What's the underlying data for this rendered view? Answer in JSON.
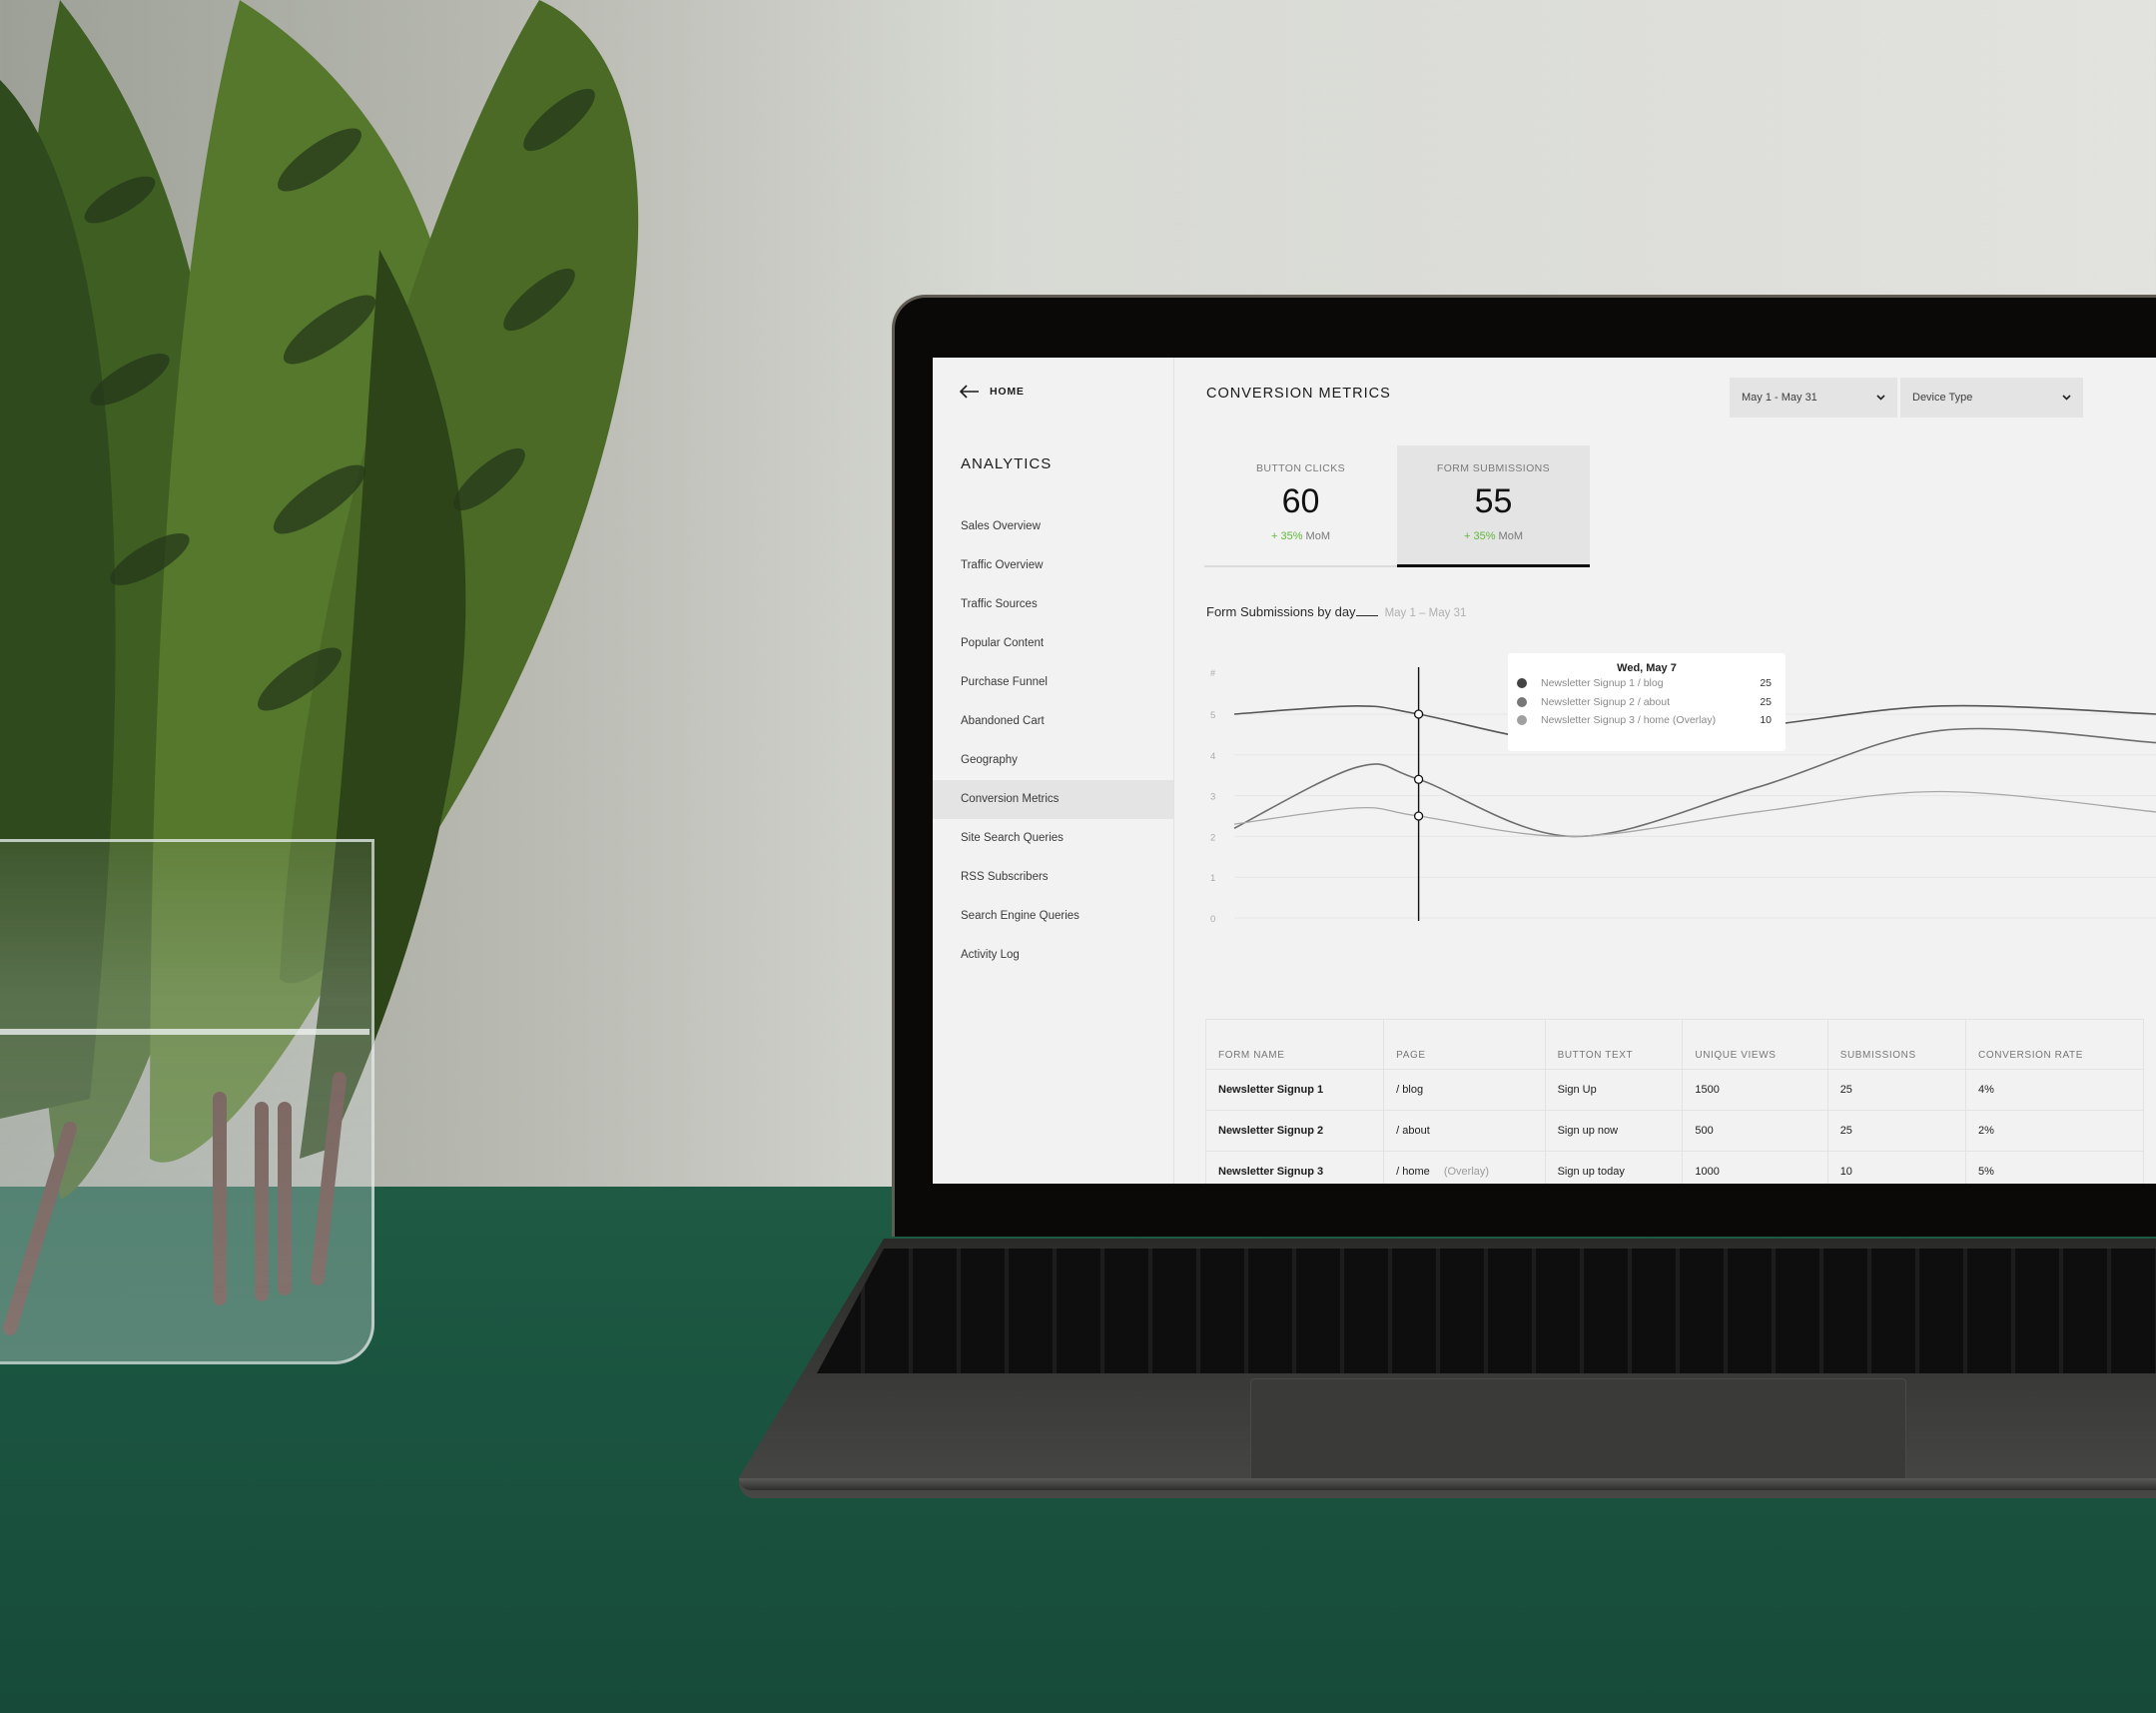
{
  "sidebar": {
    "back_label": "HOME",
    "title": "ANALYTICS",
    "items": [
      {
        "label": "Sales Overview",
        "active": false
      },
      {
        "label": "Traffic Overview",
        "active": false
      },
      {
        "label": "Traffic Sources",
        "active": false
      },
      {
        "label": "Popular Content",
        "active": false
      },
      {
        "label": "Purchase Funnel",
        "active": false
      },
      {
        "label": "Abandoned Cart",
        "active": false
      },
      {
        "label": "Geography",
        "active": false
      },
      {
        "label": "Conversion Metrics",
        "active": true
      },
      {
        "label": "Site Search Queries",
        "active": false
      },
      {
        "label": "RSS Subscribers",
        "active": false
      },
      {
        "label": "Search Engine Queries",
        "active": false
      },
      {
        "label": "Activity Log",
        "active": false
      }
    ]
  },
  "header": {
    "title": "CONVERSION METRICS",
    "date_filter": "May 1 - May 31",
    "device_filter": "Device Type"
  },
  "metrics": [
    {
      "label": "BUTTON CLICKS",
      "value": "60",
      "delta": "+ 35%",
      "delta_suffix": "MoM",
      "selected": false
    },
    {
      "label": "FORM SUBMISSIONS",
      "value": "55",
      "delta": "+ 35%",
      "delta_suffix": "MoM",
      "selected": true
    }
  ],
  "colors": {
    "positive": "#5fb83a",
    "series1": "#555555",
    "series2": "#6e6e6e",
    "series3": "#a8a8a8"
  },
  "chart_heading": {
    "title": "Form Submissions by day",
    "range": "May 1 – May 31"
  },
  "chart_data": {
    "type": "line",
    "title": "Form Submissions by day",
    "ylabel": "#",
    "ylim": [
      0,
      6
    ],
    "yticks": [
      "0",
      "1",
      "2",
      "3",
      "4",
      "5"
    ],
    "grid": true,
    "x": [
      1,
      7,
      13,
      19,
      25,
      31
    ],
    "series": [
      {
        "name": "Newsletter Signup 1 / blog",
        "values": [
          5.0,
          5.2,
          5.0,
          4.3,
          4.7,
          5.2,
          5.0
        ]
      },
      {
        "name": "Newsletter Signup 2 / about",
        "values": [
          2.2,
          3.7,
          3.4,
          2.0,
          3.2,
          4.6,
          4.3
        ]
      },
      {
        "name": "Newsletter Signup 3 / home (Overlay)",
        "values": [
          2.3,
          2.7,
          2.5,
          2.0,
          2.6,
          3.1,
          2.6
        ]
      }
    ],
    "series_x": [
      1,
      5,
      7,
      12,
      18,
      24,
      31
    ],
    "hover": {
      "x": 7,
      "label": "Wed, May 7",
      "rows": [
        {
          "name": "Newsletter Signup 1 / blog",
          "value": "25"
        },
        {
          "name": "Newsletter Signup 2 / about",
          "value": "25"
        },
        {
          "name": "Newsletter Signup 3 / home (Overlay)",
          "value": "10"
        }
      ]
    }
  },
  "table": {
    "columns": [
      "FORM NAME",
      "PAGE",
      "BUTTON TEXT",
      "UNIQUE VIEWS",
      "SUBMISSIONS",
      "CONVERSION RATE"
    ],
    "rows": [
      {
        "form_name": "Newsletter Signup 1",
        "page": "/ blog",
        "page_note": "",
        "button_text": "Sign Up",
        "unique_views": "1500",
        "submissions": "25",
        "conversion_rate": "4%"
      },
      {
        "form_name": "Newsletter Signup 2",
        "page": "/ about",
        "page_note": "",
        "button_text": "Sign up now",
        "unique_views": "500",
        "submissions": "25",
        "conversion_rate": "2%"
      },
      {
        "form_name": "Newsletter Signup 3",
        "page": "/ home",
        "page_note": "(Overlay)",
        "button_text": "Sign up today",
        "unique_views": "1000",
        "submissions": "10",
        "conversion_rate": "5%"
      }
    ]
  }
}
